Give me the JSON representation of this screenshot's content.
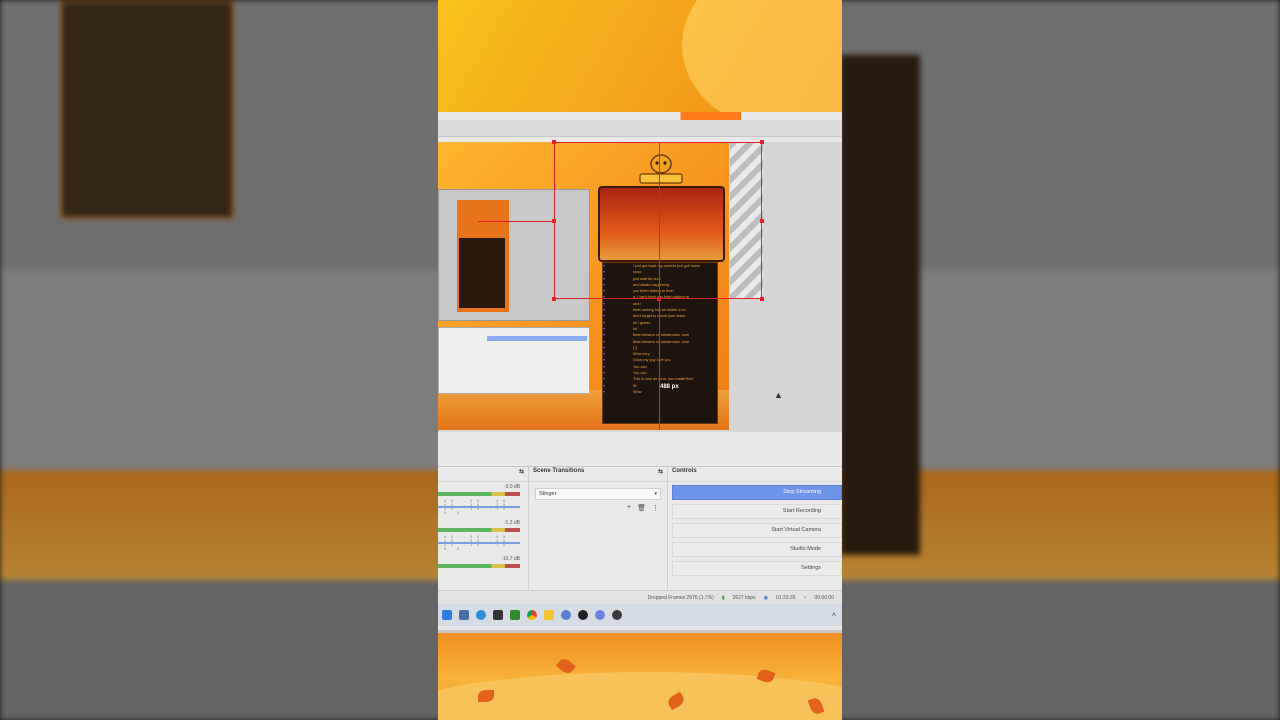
{
  "obs": {
    "preview": {
      "size_label": "488 px",
      "chat_lines": [
        {
          "user": "",
          "msg": "I just got back my parents just got home"
        },
        {
          "user": "",
          "msg": "sooo"
        },
        {
          "user": "",
          "msg": "just wait for ours"
        },
        {
          "user": "",
          "msg": "and whats happening"
        },
        {
          "user": "",
          "msg": "you been talking to level"
        },
        {
          "user": "",
          "msg": "a. I can't hear you been talking to"
        },
        {
          "user": "",
          "msg": "and I"
        },
        {
          "user": "",
          "msg": "been seeing him on twitter a lot"
        },
        {
          "user": "",
          "msg": "don't forget to check your team"
        },
        {
          "user": "",
          "msg": "ok I guess"
        },
        {
          "user": "",
          "msg": "lol"
        },
        {
          "user": "",
          "msg": "Best viewers on streamdrax .com"
        },
        {
          "user": "",
          "msg": "Best viewers on streamdrax .com"
        },
        {
          "user": "",
          "msg": "[?]"
        },
        {
          "user": "",
          "msg": "Wow very"
        },
        {
          "user": "",
          "msg": "Good my guy love you"
        },
        {
          "user": "",
          "msg": "You can"
        },
        {
          "user": "",
          "msg": "You can"
        },
        {
          "user": "",
          "msg": "This is cool as heck, you made this?"
        },
        {
          "user": "",
          "msg": "W"
        },
        {
          "user": "",
          "msg": "Wow"
        }
      ]
    },
    "audio_mixer": {
      "db_values": [
        "0.0 dB",
        "-1.3 dB",
        "-10.7 dB"
      ],
      "scale": "-60 -55 -45 -40 -35 -25 -20 -15 -10 -5 0"
    },
    "scene_transitions": {
      "title": "Scene Transitions",
      "selected": "Stinger"
    },
    "controls": {
      "title": "Controls",
      "buttons": [
        "Stop Streaming",
        "Start Recording",
        "Start Virtual Camera",
        "Studio Mode",
        "Settings"
      ]
    },
    "status_bar": {
      "dropped_frames": "Dropped Frames 2576 (1.7%)",
      "bitrate": "2627 kbps",
      "stream_time": "01:23:36",
      "record_time": "00:00:00"
    }
  },
  "colors": {
    "selection": "#e0202a",
    "active_button": "#6e93e8",
    "overlay_orange": "#f08a18"
  },
  "taskbar_icons": [
    "windows-icon",
    "file-explorer-icon",
    "edge-icon",
    "store-icon",
    "xbox-icon",
    "chrome-icon",
    "folder-icon",
    "settings-icon",
    "obs-icon",
    "discord-icon",
    "media-player-icon"
  ]
}
